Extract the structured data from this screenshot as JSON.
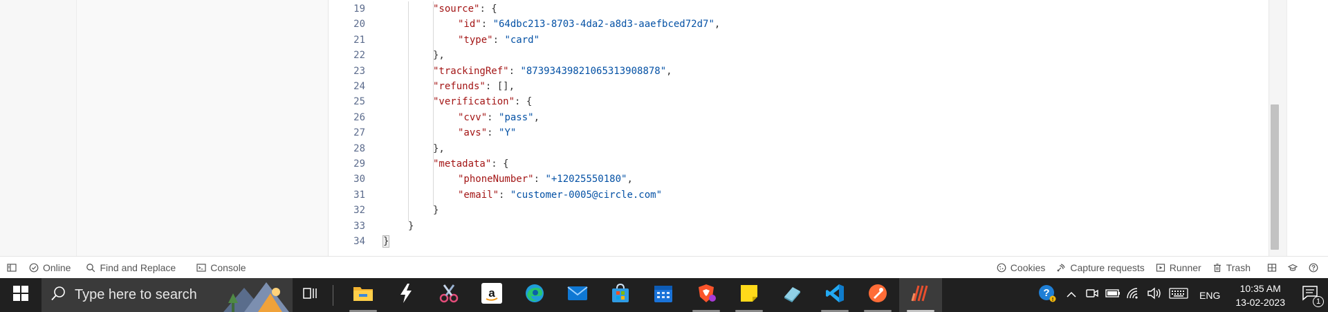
{
  "editor": {
    "lines": [
      {
        "n": "19",
        "indent": 2,
        "parts": [
          [
            "k",
            "\"source\""
          ],
          [
            "p",
            ": {"
          ]
        ]
      },
      {
        "n": "20",
        "indent": 3,
        "parts": [
          [
            "k",
            "\"id\""
          ],
          [
            "p",
            ": "
          ],
          [
            "s",
            "\"64dbc213-8703-4da2-a8d3-aaefbced72d7\""
          ],
          [
            "p",
            ","
          ]
        ]
      },
      {
        "n": "21",
        "indent": 3,
        "parts": [
          [
            "k",
            "\"type\""
          ],
          [
            "p",
            ": "
          ],
          [
            "s",
            "\"card\""
          ]
        ]
      },
      {
        "n": "22",
        "indent": 2,
        "parts": [
          [
            "p",
            "},"
          ]
        ]
      },
      {
        "n": "23",
        "indent": 2,
        "parts": [
          [
            "k",
            "\"trackingRef\""
          ],
          [
            "p",
            ": "
          ],
          [
            "s",
            "\"87393439821065313908878\""
          ],
          [
            "p",
            ","
          ]
        ]
      },
      {
        "n": "24",
        "indent": 2,
        "parts": [
          [
            "k",
            "\"refunds\""
          ],
          [
            "p",
            ": [],"
          ]
        ]
      },
      {
        "n": "25",
        "indent": 2,
        "parts": [
          [
            "k",
            "\"verification\""
          ],
          [
            "p",
            ": {"
          ]
        ]
      },
      {
        "n": "26",
        "indent": 3,
        "parts": [
          [
            "k",
            "\"cvv\""
          ],
          [
            "p",
            ": "
          ],
          [
            "s",
            "\"pass\""
          ],
          [
            "p",
            ","
          ]
        ]
      },
      {
        "n": "27",
        "indent": 3,
        "parts": [
          [
            "k",
            "\"avs\""
          ],
          [
            "p",
            ": "
          ],
          [
            "s",
            "\"Y\""
          ]
        ]
      },
      {
        "n": "28",
        "indent": 2,
        "parts": [
          [
            "p",
            "},"
          ]
        ]
      },
      {
        "n": "29",
        "indent": 2,
        "parts": [
          [
            "k",
            "\"metadata\""
          ],
          [
            "p",
            ": {"
          ]
        ]
      },
      {
        "n": "30",
        "indent": 3,
        "parts": [
          [
            "k",
            "\"phoneNumber\""
          ],
          [
            "p",
            ": "
          ],
          [
            "s",
            "\"+12025550180\""
          ],
          [
            "p",
            ","
          ]
        ]
      },
      {
        "n": "31",
        "indent": 3,
        "parts": [
          [
            "k",
            "\"email\""
          ],
          [
            "p",
            ": "
          ],
          [
            "s",
            "\"customer-0005@circle.com\""
          ]
        ]
      },
      {
        "n": "32",
        "indent": 2,
        "parts": [
          [
            "p",
            "}"
          ]
        ]
      },
      {
        "n": "33",
        "indent": 1,
        "parts": [
          [
            "p",
            "}"
          ]
        ]
      },
      {
        "n": "34",
        "indent": 0,
        "parts": [
          [
            "p",
            "}"
          ]
        ]
      }
    ]
  },
  "statusbar": {
    "online_label": "Online",
    "find_replace_label": "Find and Replace",
    "console_label": "Console",
    "cookies_label": "Cookies",
    "capture_label": "Capture requests",
    "runner_label": "Runner",
    "trash_label": "Trash"
  },
  "taskbar": {
    "search_placeholder": "Type here to search",
    "apps": [
      {
        "name": "file-explorer",
        "icon": "folder-icon"
      },
      {
        "name": "postman-like-app",
        "icon": "lightning-icon"
      },
      {
        "name": "snipping-tool",
        "icon": "scissors-icon"
      },
      {
        "name": "amazon",
        "icon": "amazon-icon"
      },
      {
        "name": "edge",
        "icon": "edge-icon"
      },
      {
        "name": "mail",
        "icon": "mail-icon"
      },
      {
        "name": "store",
        "icon": "store-icon"
      },
      {
        "name": "calendar",
        "icon": "calendar-icon"
      },
      {
        "name": "brave",
        "icon": "brave-icon"
      },
      {
        "name": "sticky-notes",
        "icon": "sticky-note-icon"
      },
      {
        "name": "eraser-app",
        "icon": "eraser-icon"
      },
      {
        "name": "vscode",
        "icon": "vscode-icon"
      },
      {
        "name": "postman",
        "icon": "postman-icon"
      },
      {
        "name": "bars-app",
        "icon": "bars-icon"
      }
    ],
    "language": "ENG",
    "time": "10:35 AM",
    "date": "13-02-2023",
    "notification_count": "1"
  },
  "colors": {
    "json_key": "#a31515",
    "json_string": "#0451a5",
    "line_number": "#5b6b8c",
    "taskbar_bg": "#202020"
  }
}
